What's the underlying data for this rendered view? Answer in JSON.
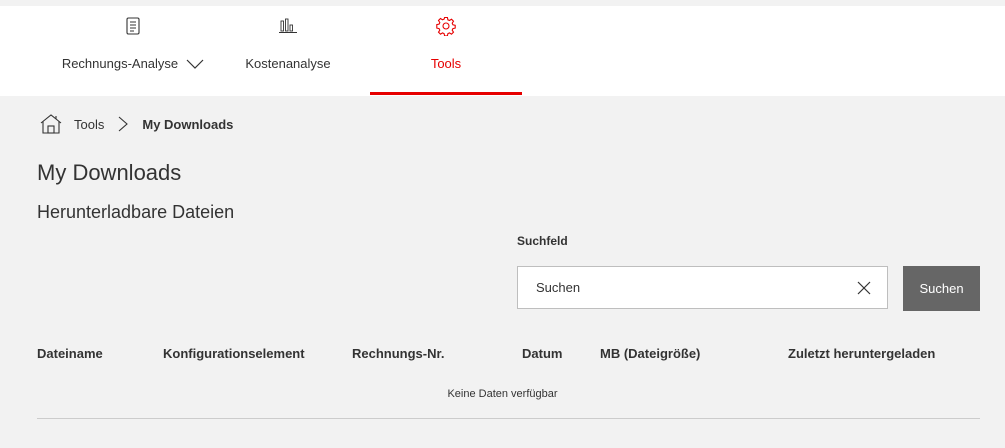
{
  "nav": {
    "tabs": [
      {
        "label": "Rechnungs-Analyse",
        "icon": "document-icon",
        "has_dropdown": true
      },
      {
        "label": "Kostenanalyse",
        "icon": "bar-chart-icon",
        "has_dropdown": false
      },
      {
        "label": "Tools",
        "icon": "gear-icon",
        "has_dropdown": false,
        "active": true
      }
    ]
  },
  "breadcrumb": {
    "home_icon": "home-icon",
    "parent": "Tools",
    "current": "My Downloads"
  },
  "page": {
    "title": "My Downloads",
    "subtitle": "Herunterladbare Dateien"
  },
  "search": {
    "label": "Suchfeld",
    "placeholder": "Suchen",
    "button_label": "Suchen"
  },
  "table": {
    "columns": [
      "Dateiname",
      "Konfigurationselement",
      "Rechnungs-Nr.",
      "Datum",
      "MB (Dateigröße)",
      "Zuletzt heruntergeladen"
    ],
    "empty_message": "Keine Daten verfügbar"
  },
  "colors": {
    "accent": "#e60000",
    "button": "#666666",
    "background": "#f2f2f2"
  }
}
